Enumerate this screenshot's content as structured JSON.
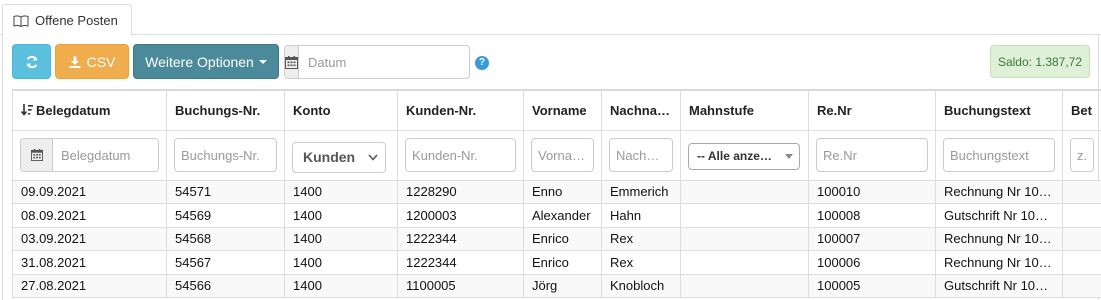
{
  "tab": {
    "label": "Offene Posten"
  },
  "toolbar": {
    "csv_label": "CSV",
    "more_label": "Weitere Optionen",
    "date_placeholder": "Datum",
    "help_glyph": "?",
    "saldo": "Saldo: 1.387,72"
  },
  "table": {
    "headers": [
      "Belegdatum",
      "Buchungs-Nr.",
      "Konto",
      "Kunden-Nr.",
      "Vorname",
      "Nachna…",
      "Mahnstufe",
      "Re.Nr",
      "Buchungstext",
      "Bet"
    ],
    "filters": {
      "belegdatum": "Belegdatum",
      "buchungsnr": "Buchungs-Nr.",
      "konto": "Kunden",
      "kundennr": "Kunden-Nr.",
      "vorname": "Vorna…",
      "nachname": "Nach…",
      "mahnstufe": "-- Alle anze…",
      "renr": "Re.Nr",
      "buchungstext": "Buchungstext",
      "betrag": "z."
    },
    "rows": [
      [
        "09.09.2021",
        "54571",
        "1400",
        "1228290",
        "Enno",
        "Emmerich",
        "",
        "100010",
        "Rechnung Nr 10…",
        ""
      ],
      [
        "08.09.2021",
        "54569",
        "1400",
        "1200003",
        "Alexander",
        "Hahn",
        "",
        "100008",
        "Gutschrift Nr 10…",
        ""
      ],
      [
        "03.09.2021",
        "54568",
        "1400",
        "1222344",
        "Enrico",
        "Rex",
        "",
        "100007",
        "Rechnung Nr 10…",
        ""
      ],
      [
        "31.08.2021",
        "54567",
        "1400",
        "1222344",
        "Enrico",
        "Rex",
        "",
        "100006",
        "Rechnung Nr 10…",
        ""
      ],
      [
        "27.08.2021",
        "54566",
        "1400",
        "1100005",
        "Jörg",
        "Knobloch",
        "",
        "100005",
        "Gutschrift Nr 10…",
        ""
      ]
    ]
  },
  "icons": {
    "tab": "book-icon",
    "refresh": "refresh-icon",
    "csv": "download-icon",
    "date": "calendar-icon",
    "help": "question-circle-icon",
    "sort": "sort-desc-icon"
  },
  "colors": {
    "refresh": "#5bc0de",
    "csv": "#f0ad4e",
    "more": "#4b8a9a",
    "saldo_bg": "#dff0d8",
    "saldo_text": "#3c763d"
  }
}
